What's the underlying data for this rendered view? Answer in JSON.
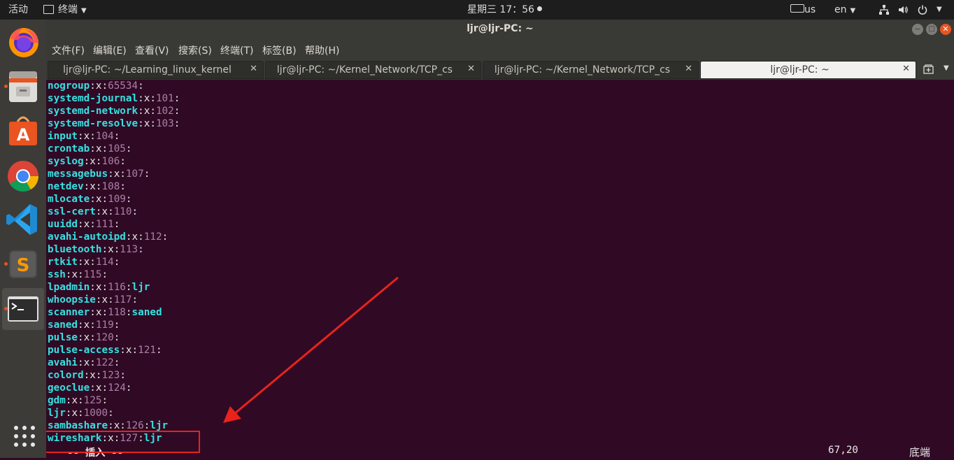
{
  "topbar": {
    "activities": "活动",
    "app_name": "终端",
    "clock": "星期三 17：56",
    "keyboard": "us",
    "language": "en",
    "icons": [
      "keyboard-icon",
      "network-icon",
      "volume-icon",
      "power-icon"
    ]
  },
  "window": {
    "title": "ljr@ljr-PC: ~"
  },
  "menubar": {
    "items": [
      "文件(F)",
      "编辑(E)",
      "查看(V)",
      "搜索(S)",
      "终端(T)",
      "标签(B)",
      "帮助(H)"
    ]
  },
  "tabs": [
    {
      "label": "ljr@ljr-PC: ~/Learning_linux_kernel",
      "active": false
    },
    {
      "label": "ljr@ljr-PC: ~/Kernel_Network/TCP_cs",
      "active": false
    },
    {
      "label": "ljr@ljr-PC: ~/Kernel_Network/TCP_cs",
      "active": false
    },
    {
      "label": "ljr@ljr-PC: ~",
      "active": true
    }
  ],
  "dock": {
    "items": [
      "firefox-icon",
      "files-icon",
      "software-center-icon",
      "chrome-icon",
      "vscode-icon",
      "sublime-text-icon",
      "terminal-icon"
    ],
    "show_apps": "show-apps-icon"
  },
  "terminal": {
    "lines": [
      [
        "nogroup",
        "65534",
        ""
      ],
      [
        "systemd-journal",
        "101",
        ""
      ],
      [
        "systemd-network",
        "102",
        ""
      ],
      [
        "systemd-resolve",
        "103",
        ""
      ],
      [
        "input",
        "104",
        ""
      ],
      [
        "crontab",
        "105",
        ""
      ],
      [
        "syslog",
        "106",
        ""
      ],
      [
        "messagebus",
        "107",
        ""
      ],
      [
        "netdev",
        "108",
        ""
      ],
      [
        "mlocate",
        "109",
        ""
      ],
      [
        "ssl-cert",
        "110",
        ""
      ],
      [
        "uuidd",
        "111",
        ""
      ],
      [
        "avahi-autoipd",
        "112",
        ""
      ],
      [
        "bluetooth",
        "113",
        ""
      ],
      [
        "rtkit",
        "114",
        ""
      ],
      [
        "ssh",
        "115",
        ""
      ],
      [
        "lpadmin",
        "116",
        "ljr"
      ],
      [
        "whoopsie",
        "117",
        ""
      ],
      [
        "scanner",
        "118",
        "saned"
      ],
      [
        "saned",
        "119",
        ""
      ],
      [
        "pulse",
        "120",
        ""
      ],
      [
        "pulse-access",
        "121",
        ""
      ],
      [
        "avahi",
        "122",
        ""
      ],
      [
        "colord",
        "123",
        ""
      ],
      [
        "geoclue",
        "124",
        ""
      ],
      [
        "gdm",
        "125",
        ""
      ],
      [
        "ljr",
        "1000",
        ""
      ],
      [
        "sambashare",
        "126",
        "ljr"
      ],
      [
        "wireshark",
        "127",
        "ljr"
      ]
    ],
    "password_field": "x",
    "separator": ":",
    "status_mode": "-- 插入 --",
    "cursor_pos": "67,20",
    "scroll_pos": "底端"
  },
  "annotation": {
    "highlight_color": "#e8231c"
  }
}
